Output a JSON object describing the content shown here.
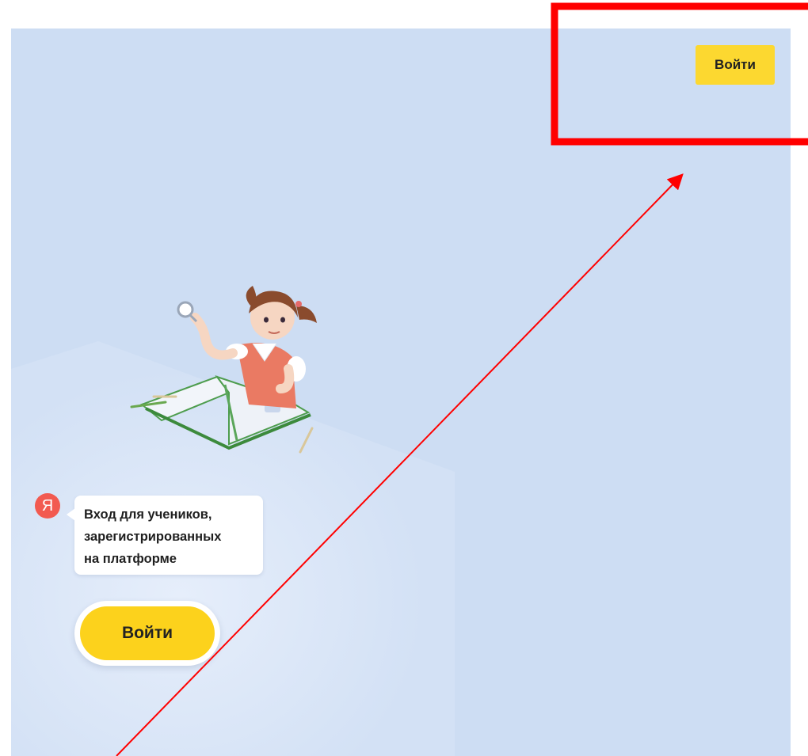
{
  "header": {
    "login_label": "Войти"
  },
  "brand": {
    "logo_letter": "Я"
  },
  "main": {
    "message_lines": [
      "Вход для учеников,",
      "зарегистрированных",
      "на платформе"
    ],
    "login_label": "Войти"
  },
  "colors": {
    "background": "#cdddf3",
    "accent_yellow": "#fcd21c",
    "yandex_red": "#f25a50",
    "annotation_red": "#ff0000"
  }
}
